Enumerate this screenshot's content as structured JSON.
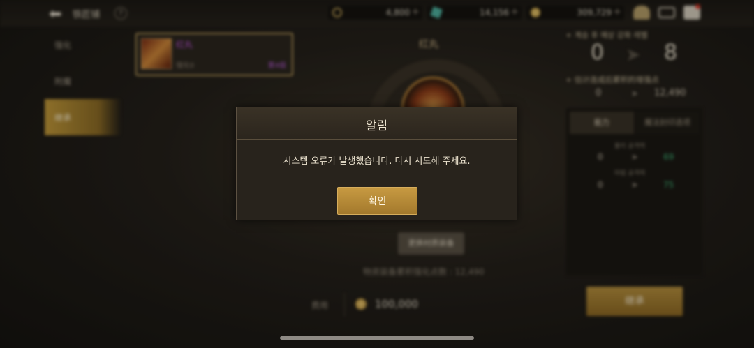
{
  "header": {
    "title": "铁匠铺",
    "currencies": [
      {
        "icon": "moon-currency-icon",
        "amount": "4,800",
        "color": "#c9a85a"
      },
      {
        "icon": "gem-currency-icon",
        "amount": "14,156",
        "color": "#4fb3a0"
      },
      {
        "icon": "gold-coin-icon",
        "amount": "309,729",
        "color": "#d8b050"
      }
    ],
    "plus": "+"
  },
  "sidebar": {
    "items": [
      {
        "label": "强化"
      },
      {
        "label": "附魔"
      },
      {
        "label": "继承"
      }
    ]
  },
  "item": {
    "name": "红丸",
    "level": "强化0",
    "tag": "第4级"
  },
  "center": {
    "title": "红丸",
    "change_button": "更换材质装备",
    "points_note": "物资装备累积强化点数 : 12,490"
  },
  "cost": {
    "label": "费用",
    "value": "100,000"
  },
  "right": {
    "level_heading": "+ 계승 후 예상 강화 레벨",
    "level_from": "0",
    "level_to": "8",
    "points_heading": "+ 估计连成后累积的增强点",
    "points_from": "0",
    "points_to": "12,490",
    "tabs": [
      "能力",
      "魔法封印选项"
    ],
    "stats": [
      {
        "label": "물리 공격력",
        "from": "0",
        "to": "69"
      },
      {
        "label": "마법 공격력",
        "from": "0",
        "to": "75"
      }
    ],
    "inherit_button": "继承"
  },
  "dialog": {
    "title": "알림",
    "message": "시스템 오류가 발생했습니다. 다시 시도해 주세요.",
    "ok": "확인"
  },
  "colors": {
    "accent": "#b8913e",
    "purple": "#c455e0",
    "green": "#3fb878"
  }
}
